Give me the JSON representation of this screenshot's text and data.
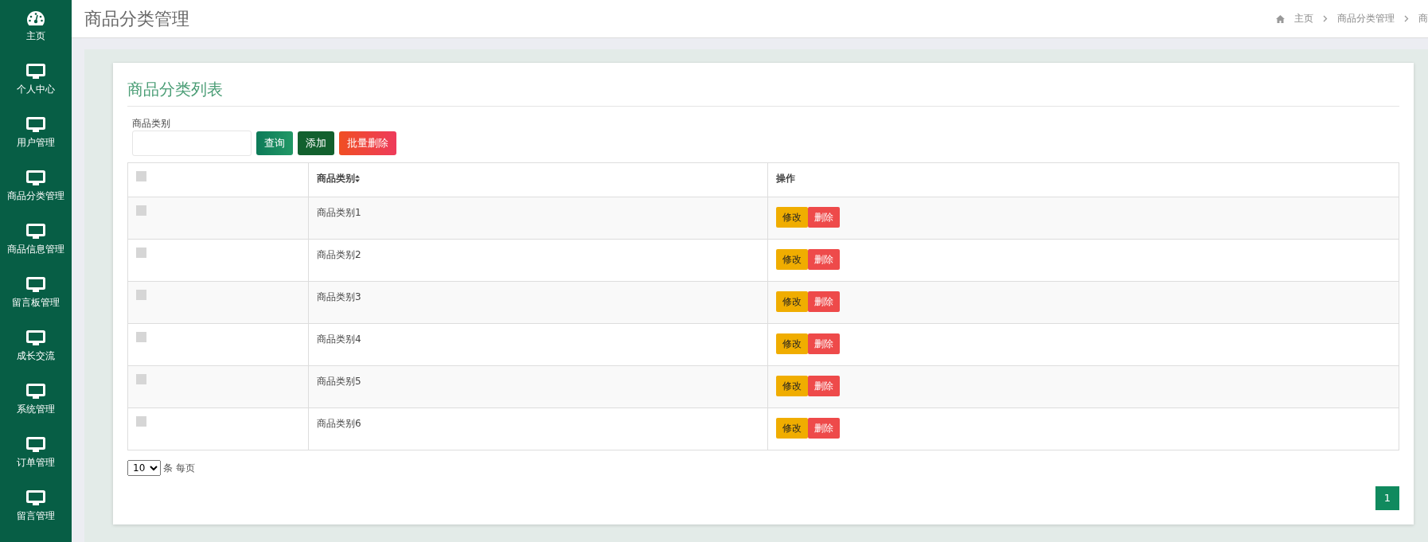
{
  "sidebar": {
    "items": [
      {
        "label": "主页",
        "kind": "dashboard"
      },
      {
        "label": "个人中心",
        "kind": "monitor"
      },
      {
        "label": "用户管理",
        "kind": "monitor"
      },
      {
        "label": "商品分类管理",
        "kind": "monitor"
      },
      {
        "label": "商品信息管理",
        "kind": "monitor"
      },
      {
        "label": "留言板管理",
        "kind": "monitor"
      },
      {
        "label": "成长交流",
        "kind": "monitor"
      },
      {
        "label": "系统管理",
        "kind": "monitor"
      },
      {
        "label": "订单管理",
        "kind": "monitor"
      },
      {
        "label": "留言管理",
        "kind": "monitor"
      }
    ]
  },
  "header": {
    "title": "商品分类管理",
    "breadcrumb": [
      "主页",
      "商品分类管理",
      "商"
    ]
  },
  "card": {
    "title": "商品分类列表",
    "search": {
      "label": "商品类别",
      "buttons": [
        {
          "label": "查询",
          "kind": "search"
        },
        {
          "label": "添加",
          "kind": "add"
        },
        {
          "label": "批量删除",
          "kind": "delete"
        }
      ]
    },
    "table": {
      "select_all_checked": false,
      "columns": [
        "商品类别",
        "操作"
      ],
      "rows": [
        {
          "name": "商品类别1",
          "checked": false,
          "actions": [
            "修改",
            "删除"
          ]
        },
        {
          "name": "商品类别2",
          "checked": false,
          "actions": [
            "修改",
            "删除"
          ]
        },
        {
          "name": "商品类别3",
          "checked": false,
          "actions": [
            "修改",
            "删除"
          ]
        },
        {
          "name": "商品类别4",
          "checked": false,
          "actions": [
            "修改",
            "删除"
          ]
        },
        {
          "name": "商品类别5",
          "checked": false,
          "actions": [
            "修改",
            "删除"
          ]
        },
        {
          "name": "商品类别6",
          "checked": false,
          "actions": [
            "修改",
            "删除"
          ]
        }
      ]
    },
    "page_size": {
      "value": "10",
      "suffix": "条 每页"
    },
    "pagination": [
      {
        "label": "1",
        "selected": true
      }
    ]
  }
}
